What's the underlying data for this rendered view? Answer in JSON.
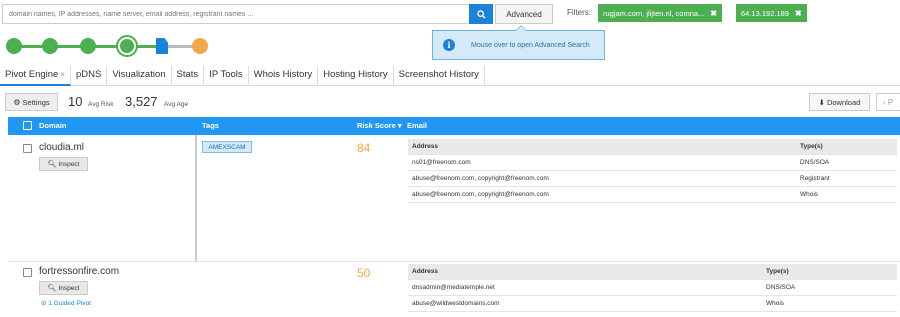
{
  "search": {
    "placeholder": "domain names, IP addresses, name server, email address, registrant names ...",
    "advanced_label": "Advanced"
  },
  "filters": {
    "label": "Filters:",
    "chips": [
      {
        "text": "rugjam.com, jlijten.nl, comna...",
        "close": "✖"
      },
      {
        "text": "64.13.192.189",
        "close": "✖"
      }
    ]
  },
  "tooltip": {
    "icon": "i",
    "text": "Mouse over to open Advanced Search"
  },
  "stepper": {
    "steps_completed": 4,
    "current_step": 4,
    "total_steps": 6
  },
  "tabs": [
    {
      "label": "Pivot Engine",
      "close": "×"
    },
    {
      "label": "pDNS"
    },
    {
      "label": "Visualization"
    },
    {
      "label": "Stats"
    },
    {
      "label": "IP Tools"
    },
    {
      "label": "Whois History"
    },
    {
      "label": "Hosting History"
    },
    {
      "label": "Screenshot History"
    }
  ],
  "stats": {
    "settings_label": "Settings",
    "avg_risk_value": "10",
    "avg_risk_label": "Avg Risk",
    "avg_age_value": "3,527",
    "avg_age_label": "Avg Age",
    "download_label": "Download",
    "prev_label": "‹ P"
  },
  "table": {
    "columns": {
      "domain": "Domain",
      "tags": "Tags",
      "risk": "Risk Score ▾",
      "email": "Email"
    },
    "rows": [
      {
        "domain": "cloudia.ml",
        "inspect": "Inspect",
        "tag": "AMEXSCAM",
        "score": "84",
        "email_headers": [
          "Address",
          "Type(s)"
        ],
        "emails": [
          {
            "address": "ns01@freenom.com",
            "type": "DNS/SOA"
          },
          {
            "address": "abuse@freenom.com, copyright@freenom.com",
            "type": "Registrant"
          },
          {
            "address": "abuse@freenom.com, copyright@freenom.com",
            "type": "Whois"
          }
        ]
      },
      {
        "domain": "fortressonfire.com",
        "inspect": "Inspect",
        "guided": "1 Guided Pivot",
        "score": "50",
        "email_headers": [
          "Address",
          "Type(s)"
        ],
        "emails": [
          {
            "address": "dnsadmin@mediatemple.net",
            "type": "DNS/SOA"
          },
          {
            "address": "abuse@wildwestdomains.com",
            "type": "Whois"
          }
        ]
      }
    ]
  },
  "colors": {
    "accent": "#2196f3",
    "green": "#4caf50",
    "orange": "#f5a84a"
  }
}
